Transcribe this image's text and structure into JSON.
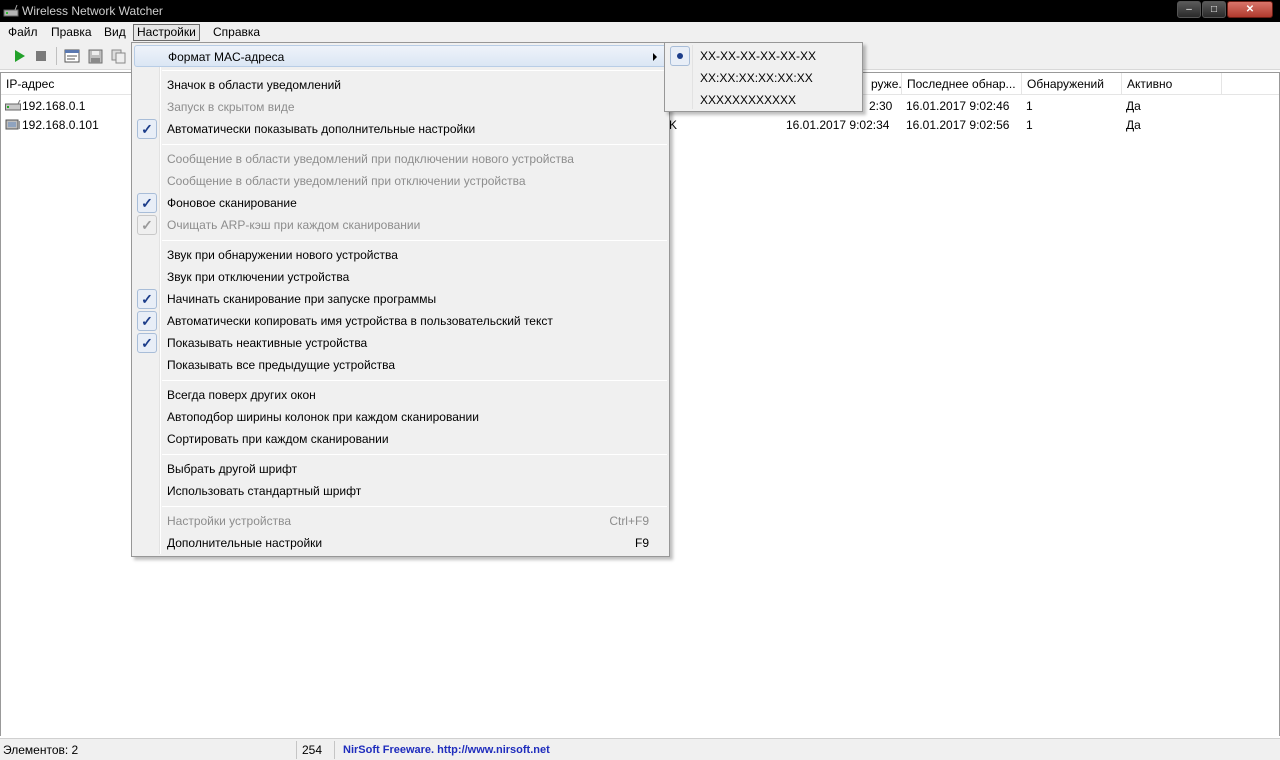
{
  "window": {
    "title": "Wireless Network Watcher",
    "minimize": "‒",
    "maximize": "□",
    "close": "✕"
  },
  "menubar": {
    "items": [
      {
        "label": "Файл"
      },
      {
        "label": "Правка"
      },
      {
        "label": "Вид"
      },
      {
        "label": "Настройки"
      },
      {
        "label": "Справка"
      }
    ]
  },
  "toolbar": {
    "buttons": [
      {
        "icon": "play-icon",
        "color": "#22a12a"
      },
      {
        "icon": "stop-icon",
        "color": "#7a7a7a"
      },
      {
        "icon": "properties-icon"
      },
      {
        "icon": "save-icon"
      },
      {
        "icon": "copy-icon"
      }
    ]
  },
  "table": {
    "columns": [
      {
        "label": "IP-адрес"
      },
      {
        "label": "руже..."
      },
      {
        "label": "Последнее обнар..."
      },
      {
        "label": "Обнаружений"
      },
      {
        "label": "Активно"
      }
    ],
    "rows": [
      {
        "ip": "192.168.0.1",
        "partial": "",
        "first_seen": "2:30",
        "last_seen": "16.01.2017 9:02:46",
        "count": "1",
        "active": "Да"
      },
      {
        "ip": "192.168.0.101",
        "partial": "K",
        "first_seen": "16.01.2017 9:02:34",
        "last_seen": "16.01.2017 9:02:56",
        "count": "1",
        "active": "Да"
      }
    ]
  },
  "settings_menu": {
    "items": [
      {
        "label": "Формат MAC-адреса",
        "submenu": true
      },
      {
        "label": "Значок в области уведомлений"
      },
      {
        "label": "Запуск в скрытом виде",
        "disabled": true
      },
      {
        "label": "Автоматически показывать дополнительные настройки",
        "checked": true
      },
      {
        "label": "Сообщение в области уведомлений при подключении нового устройства",
        "disabled": true
      },
      {
        "label": "Сообщение в области уведомлений при отключении устройства",
        "disabled": true
      },
      {
        "label": "Фоновое сканирование",
        "checked": true
      },
      {
        "label": "Очищать ARP-кэш при каждом сканировании",
        "checked": true,
        "disabled": true
      },
      {
        "label": "Звук при обнаружении нового устройства"
      },
      {
        "label": "Звук при отключении устройства"
      },
      {
        "label": "Начинать сканирование при запуске программы",
        "checked": true
      },
      {
        "label": "Автоматически копировать имя устройства в пользовательский текст",
        "checked": true
      },
      {
        "label": "Показывать неактивные устройства",
        "checked": true
      },
      {
        "label": "Показывать все предыдущие устройства"
      },
      {
        "label": "Всегда поверх других окон"
      },
      {
        "label": "Автоподбор ширины колонок при каждом сканировании"
      },
      {
        "label": "Сортировать при каждом сканировании"
      },
      {
        "label": "Выбрать другой шрифт"
      },
      {
        "label": "Использовать стандартный шрифт"
      },
      {
        "label": "Настройки устройства",
        "shortcut": "Ctrl+F9",
        "disabled": true
      },
      {
        "label": "Дополнительные настройки",
        "shortcut": "F9"
      }
    ],
    "check_glyph": "✓"
  },
  "mac_format_submenu": {
    "items": [
      {
        "label": "XX-XX-XX-XX-XX-XX",
        "selected": true
      },
      {
        "label": "XX:XX:XX:XX:XX:XX"
      },
      {
        "label": "XXXXXXXXXXXX"
      }
    ]
  },
  "statusbar": {
    "items_count": "Элементов: 2",
    "number": "254",
    "link": "NirSoft Freeware.  http://www.nirsoft.net"
  }
}
